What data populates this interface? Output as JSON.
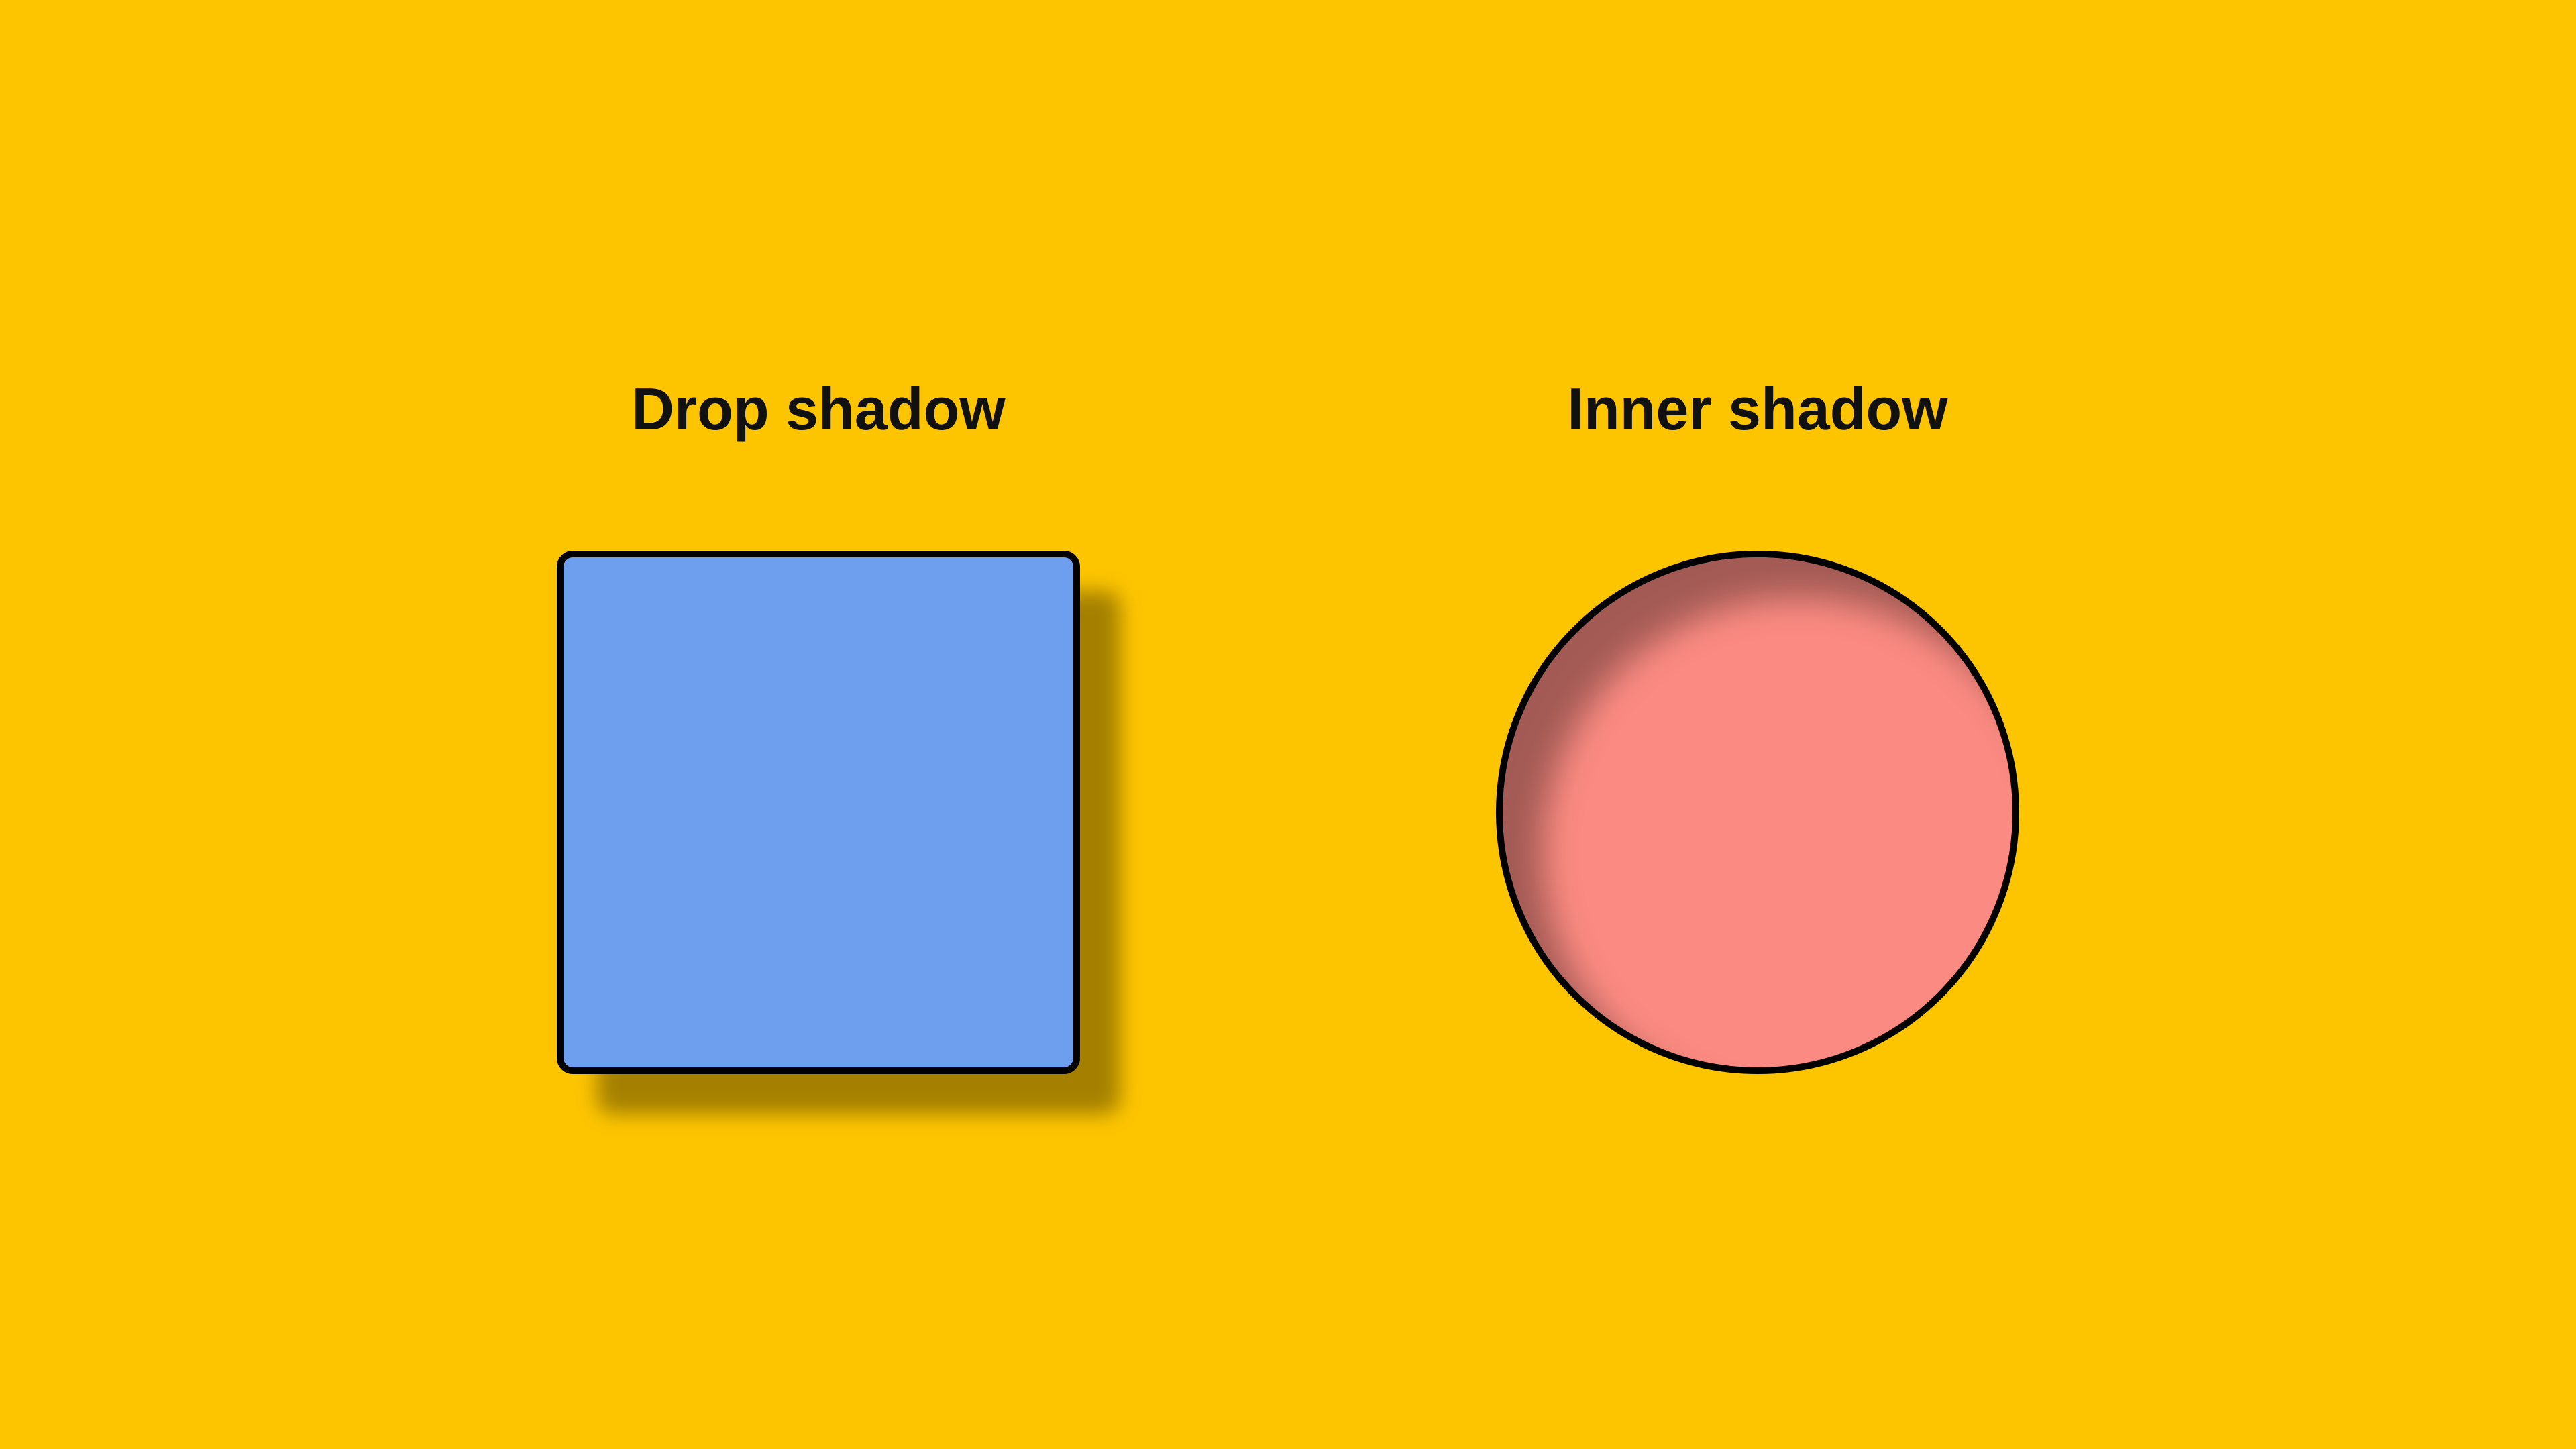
{
  "labels": {
    "drop_shadow": "Drop shadow",
    "inner_shadow": "Inner shadow"
  },
  "shapes": {
    "left": {
      "type": "rounded-square",
      "fill": "#6D9FEE",
      "stroke": "#000000",
      "corner_radius": 24,
      "effect": "drop-shadow"
    },
    "right": {
      "type": "circle",
      "fill": "#FB8B82",
      "stroke": "#000000",
      "effect": "inner-shadow"
    }
  },
  "colors": {
    "background": "#FDC500",
    "text": "#111111",
    "square_fill": "#6D9FEE",
    "circle_fill": "#FB8B82",
    "stroke": "#000000",
    "shadow": "rgba(0,0,0,0.35)"
  }
}
